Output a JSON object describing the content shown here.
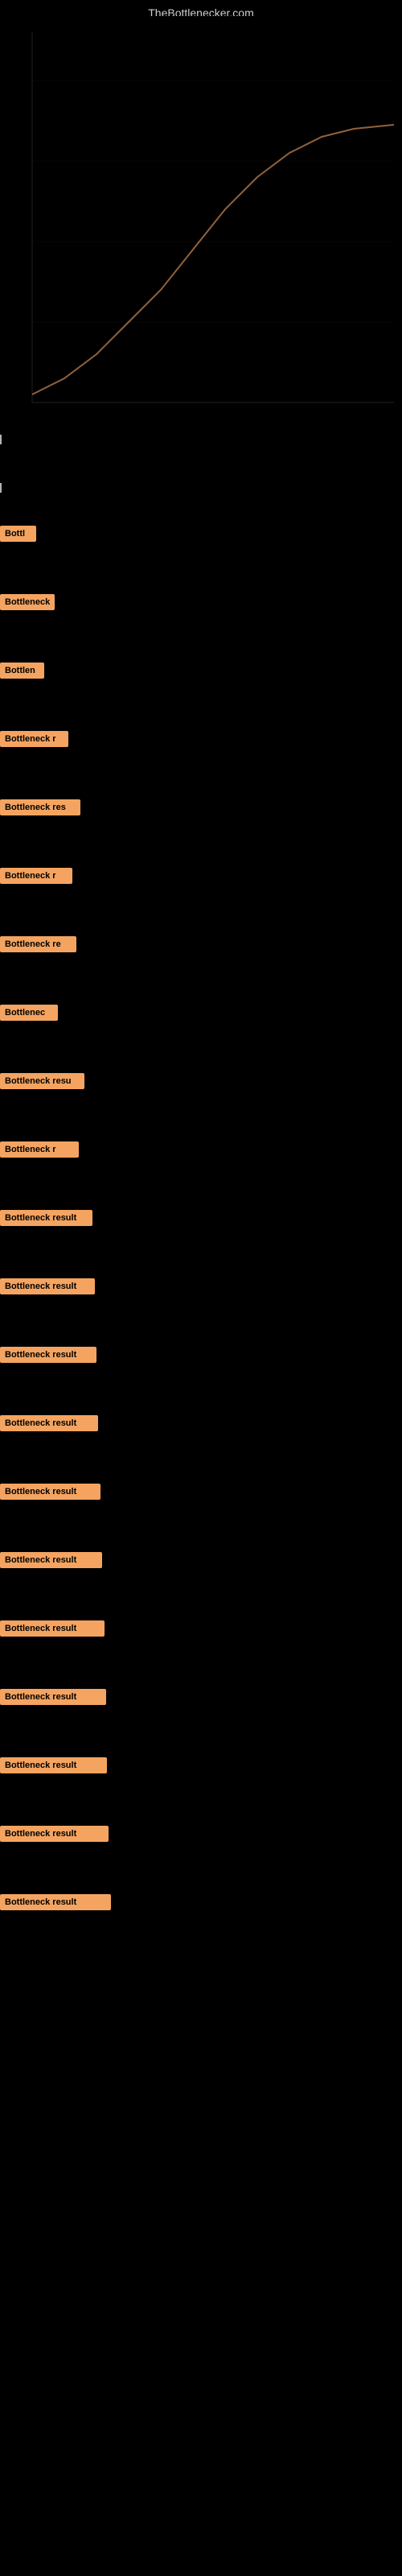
{
  "site": {
    "title": "TheBottlenecker.com"
  },
  "results": [
    {
      "label": "Bottl",
      "width_class": "badge-w1"
    },
    {
      "label": "Bottleneck",
      "width_class": "badge-w2"
    },
    {
      "label": "Bottlen",
      "width_class": "badge-w3"
    },
    {
      "label": "Bottleneck r",
      "width_class": "badge-w4"
    },
    {
      "label": "Bottleneck res",
      "width_class": "badge-w5"
    },
    {
      "label": "Bottleneck r",
      "width_class": "badge-w6"
    },
    {
      "label": "Bottleneck re",
      "width_class": "badge-w7"
    },
    {
      "label": "Bottlenec",
      "width_class": "badge-w8"
    },
    {
      "label": "Bottleneck resu",
      "width_class": "badge-w9"
    },
    {
      "label": "Bottleneck r",
      "width_class": "badge-w10"
    },
    {
      "label": "Bottleneck result",
      "width_class": "badge-w11"
    },
    {
      "label": "Bottleneck result",
      "width_class": "badge-w12"
    },
    {
      "label": "Bottleneck result",
      "width_class": "badge-w13"
    },
    {
      "label": "Bottleneck result",
      "width_class": "badge-w14"
    },
    {
      "label": "Bottleneck result",
      "width_class": "badge-w15"
    },
    {
      "label": "Bottleneck result",
      "width_class": "badge-w16"
    },
    {
      "label": "Bottleneck result",
      "width_class": "badge-w17"
    },
    {
      "label": "Bottleneck result",
      "width_class": "badge-w18"
    },
    {
      "label": "Bottleneck result",
      "width_class": "badge-w19"
    },
    {
      "label": "Bottleneck result",
      "width_class": "badge-w20"
    },
    {
      "label": "Bottleneck result",
      "width_class": "badge-w21"
    }
  ]
}
